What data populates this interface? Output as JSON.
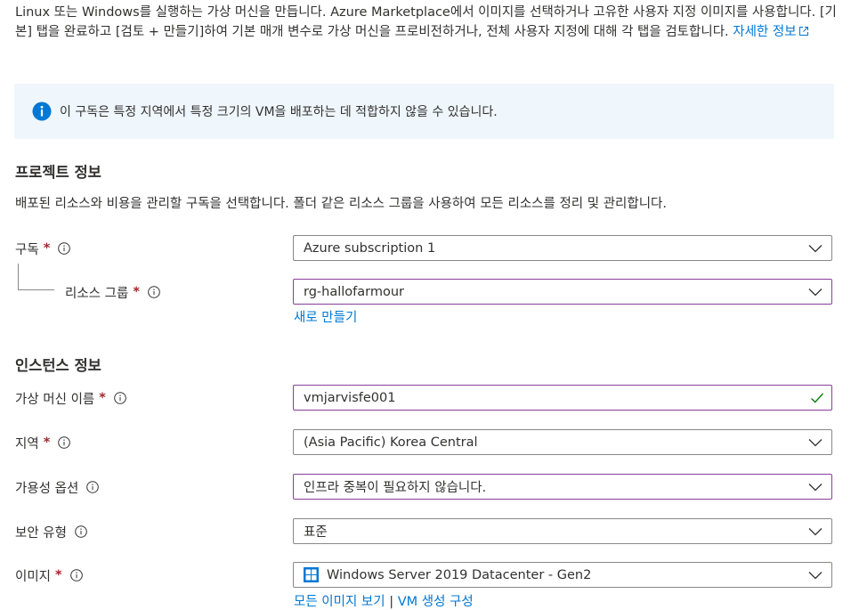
{
  "intro": {
    "text": "Linux 또는 Windows를 실행하는 가상 머신을 만듭니다. Azure Marketplace에서 이미지를 선택하거나 고유한 사용자 지정 이미지를 사용합니다. [기본] 탭을 완료하고 [검토 + 만들기]하여 기본 매개 변수로 가상 머신을 프로비전하거나, 전체 사용자 지정에 대해 각 탭을 검토합니다.",
    "learn_more": "자세한 정보"
  },
  "info_banner": {
    "message": "이 구독은 특정 지역에서 특정 크기의 VM을 배포하는 데 적합하지 않을 수 있습니다."
  },
  "project": {
    "title": "프로젝트 정보",
    "description": "배포된 리소스와 비용을 관리할 구독을 선택합니다. 폴더 같은 리소스 그룹을 사용하여 모든 리소스를 정리 및 관리합니다.",
    "subscription": {
      "label": "구독",
      "required_mark": "*",
      "value": "Azure subscription 1"
    },
    "resource_group": {
      "label": "리소스 그룹",
      "required_mark": "*",
      "value": "rg-hallofarmour",
      "create_new": "새로 만들기"
    }
  },
  "instance": {
    "title": "인스턴스 정보",
    "vm_name": {
      "label": "가상 머신 이름",
      "required_mark": "*",
      "value": "vmjarvisfe001"
    },
    "region": {
      "label": "지역",
      "required_mark": "*",
      "value": "(Asia Pacific) Korea Central"
    },
    "availability": {
      "label": "가용성 옵션",
      "value": "인프라 중복이 필요하지 않습니다."
    },
    "security": {
      "label": "보안 유형",
      "value": "표준"
    },
    "image": {
      "label": "이미지",
      "required_mark": "*",
      "value": "Windows Server 2019 Datacenter - Gen2",
      "see_all": "모든 이미지 보기",
      "separator": "|",
      "configure": "VM 생성 구성"
    }
  },
  "colors": {
    "accent": "#0078d4",
    "required": "#a4262c",
    "valid_check": "#107c10",
    "info_bg": "#eff6fc",
    "focus_border": "#8a3d9d"
  }
}
